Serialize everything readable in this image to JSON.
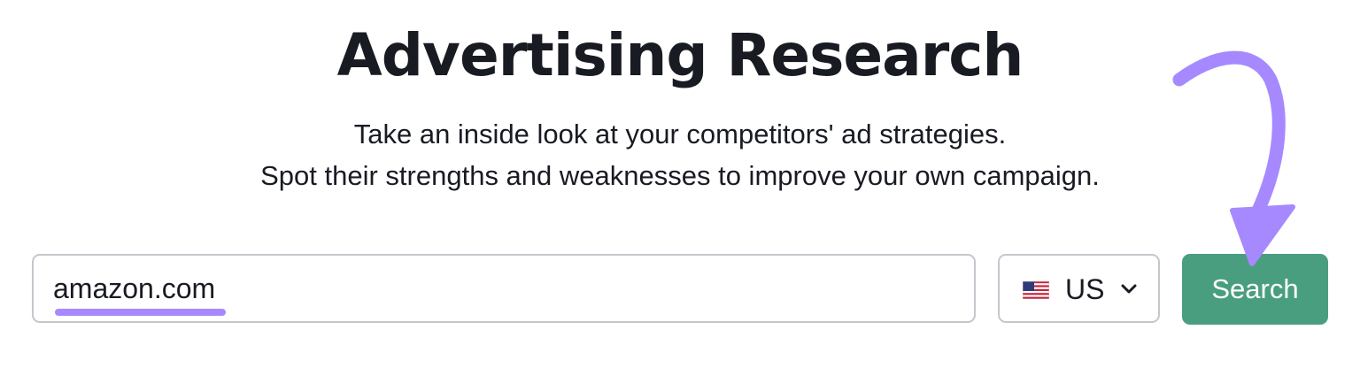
{
  "header": {
    "title": "Advertising Research",
    "subtitle_line1": "Take an inside look at your competitors' ad strategies.",
    "subtitle_line2": "Spot their strengths and weaknesses to improve your own campaign."
  },
  "search_form": {
    "domain_value": "amazon.com",
    "country": {
      "flag_icon": "us-flag-icon",
      "selected": "US"
    },
    "search_label": "Search"
  },
  "colors": {
    "accent_purple": "#a689ff",
    "button_green": "#4a9e80",
    "text_dark": "#191b23",
    "border_gray": "#c5c7cd"
  }
}
